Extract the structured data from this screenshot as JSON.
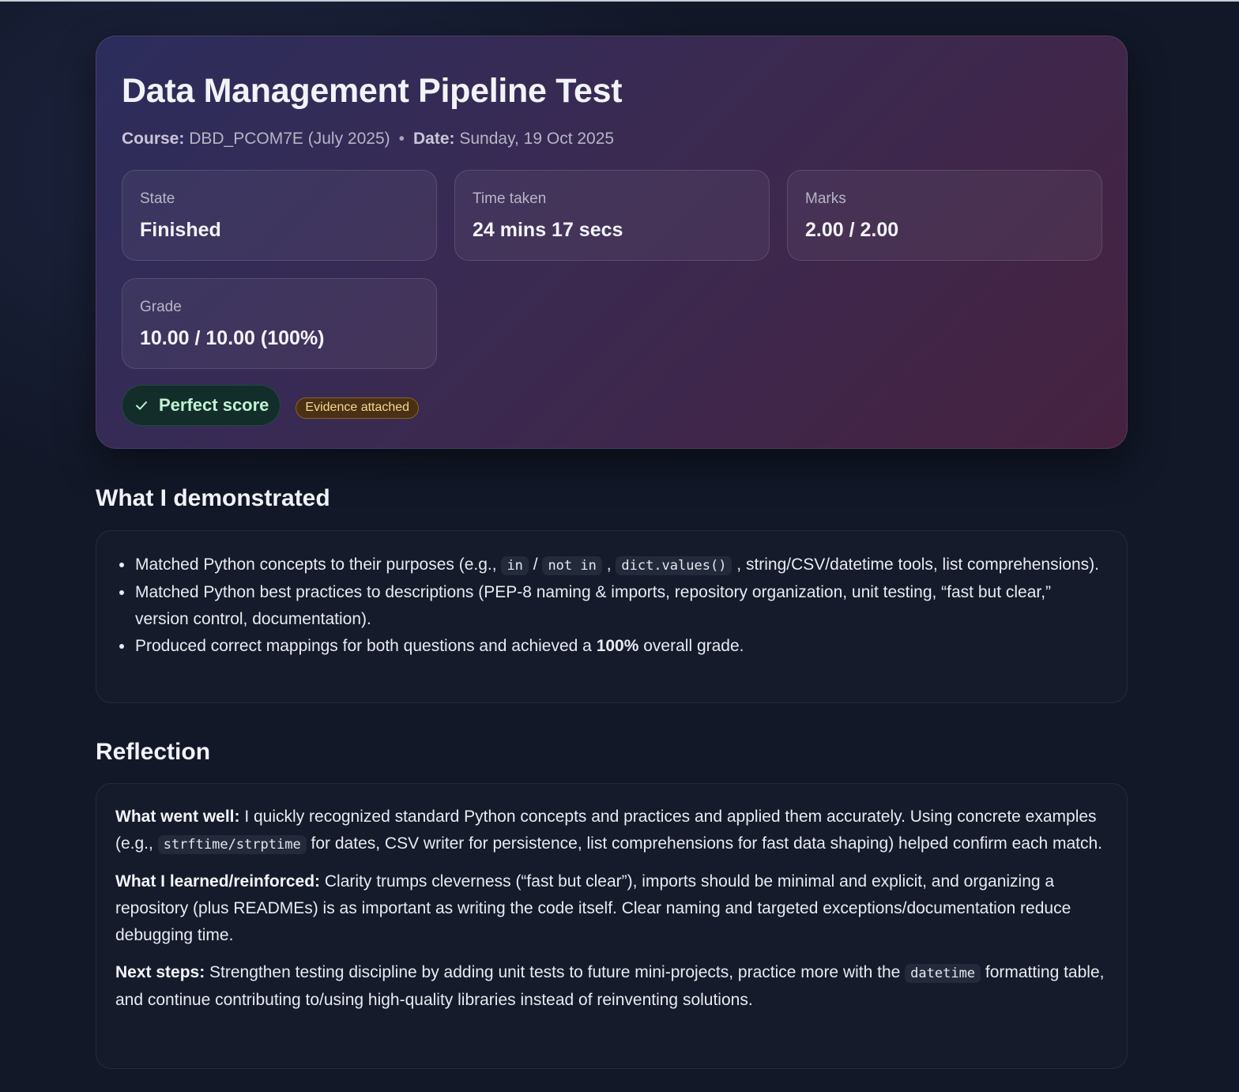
{
  "hero": {
    "title": "Data Management Pipeline Test",
    "course_label": "Course:",
    "course_value": "DBD_PCOM7E (July 2025)",
    "separator": "•",
    "date_label": "Date:",
    "date_value": "Sunday, 19 Oct 2025",
    "stats": [
      {
        "label": "State",
        "value": "Finished"
      },
      {
        "label": "Time taken",
        "value": "24 mins 17 secs"
      },
      {
        "label": "Marks",
        "value": "2.00 / 2.00"
      },
      {
        "label": "Grade",
        "value": "10.00 / 10.00 (100%)"
      }
    ],
    "badges": {
      "success": "Perfect score",
      "evidence": "Evidence attached"
    }
  },
  "demonstrated": {
    "heading": "What I demonstrated",
    "item1": {
      "before": "Matched Python concepts to their purposes (e.g., ",
      "code_in": "in",
      "slash": " / ",
      "code_not_in": "not in",
      "comma": " , ",
      "code_values": "dict.values()",
      "after": " , string/CSV/datetime tools, list comprehensions)."
    },
    "item2": "Matched Python best practices to descriptions (PEP-8 naming & imports, repository organization, unit testing, “fast but clear,” version control, documentation).",
    "item3": {
      "before": "Produced correct mappings for both questions and achieved a ",
      "bold": "100%",
      "after": " overall grade."
    }
  },
  "reflection": {
    "heading": "Reflection",
    "went_well": {
      "label": "What went well:",
      "before": " I quickly recognized standard Python concepts and practices and applied them accurately. Using concrete examples (e.g., ",
      "code": "strftime/strptime",
      "after": " for dates, CSV writer for persistence, list comprehensions for fast data shaping) helped confirm each match."
    },
    "learned": {
      "label": "What I learned/reinforced:",
      "text": " Clarity trumps cleverness (“fast but clear”), imports should be minimal and explicit, and organizing a repository (plus READMEs) is as important as writing the code itself. Clear naming and targeted exceptions/documentation reduce debugging time."
    },
    "next": {
      "label": "Next steps:",
      "before": " Strengthen testing discipline by adding unit tests to future mini-projects, practice more with the ",
      "code": "datetime",
      "after": " formatting table, and continue contributing to/using high-quality libraries instead of reinventing solutions."
    }
  },
  "colors": {
    "background": "#121828",
    "hero_gradient_start": "#2c2d5c",
    "hero_gradient_end": "#462240",
    "success_bg": "#132e2a",
    "success_text": "#bff3d6",
    "evidence_bg": "#4a3116",
    "evidence_text": "#f6d98e"
  },
  "icons": {
    "success_badge": "check-icon"
  }
}
